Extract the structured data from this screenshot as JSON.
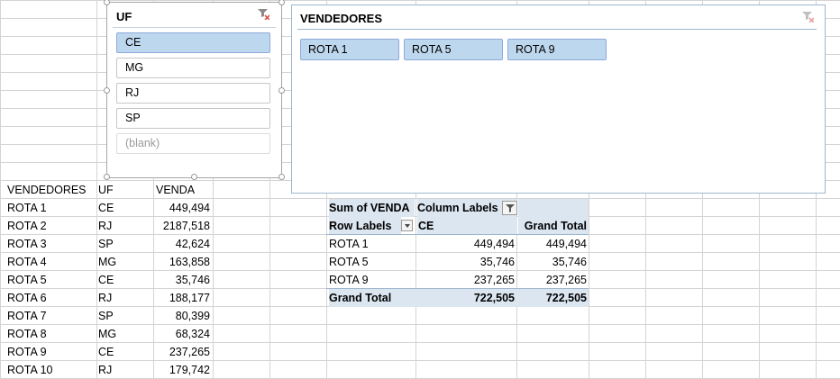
{
  "source_table": {
    "headers": [
      "VENDEDORES",
      "UF",
      "VENDA"
    ],
    "rows": [
      [
        "ROTA 1",
        "CE",
        "449,494"
      ],
      [
        "ROTA 2",
        "RJ",
        "2187,518"
      ],
      [
        "ROTA 3",
        "SP",
        "42,624"
      ],
      [
        "ROTA 4",
        "MG",
        "163,858"
      ],
      [
        "ROTA 5",
        "CE",
        "35,746"
      ],
      [
        "ROTA 6",
        "RJ",
        "188,177"
      ],
      [
        "ROTA 7",
        "SP",
        "80,399"
      ],
      [
        "ROTA 8",
        "MG",
        "68,324"
      ],
      [
        "ROTA 9",
        "CE",
        "237,265"
      ],
      [
        "ROTA 10",
        "RJ",
        "179,742"
      ]
    ]
  },
  "slicer_uf": {
    "title": "UF",
    "items": [
      {
        "label": "CE",
        "selected": true
      },
      {
        "label": "MG",
        "selected": false
      },
      {
        "label": "RJ",
        "selected": false
      },
      {
        "label": "SP",
        "selected": false
      },
      {
        "label": "(blank)",
        "selected": false
      }
    ],
    "clear_filter_icon": "clear-filter-icon"
  },
  "slicer_vendedores": {
    "title": "VENDEDORES",
    "items": [
      "ROTA 1",
      "ROTA 5",
      "ROTA 9"
    ],
    "clear_filter_icon": "clear-filter-icon"
  },
  "pivot": {
    "value_label": "Sum of VENDA",
    "column_labels": "Column Labels",
    "row_labels": "Row Labels",
    "column_header": "CE",
    "grand_total_header": "Grand Total",
    "rows": [
      [
        "ROTA 1",
        "449,494",
        "449,494"
      ],
      [
        "ROTA 5",
        "35,746",
        "35,746"
      ],
      [
        "ROTA 9",
        "237,265",
        "237,265"
      ]
    ],
    "total_row": [
      "Grand Total",
      "722,505",
      "722,505"
    ]
  },
  "colors": {
    "selected_item": "#bdd7ee",
    "pivot_header_fill": "#dce6f1",
    "gridline": "#d4d4d4",
    "slicer_border": "#9eb6ce"
  }
}
